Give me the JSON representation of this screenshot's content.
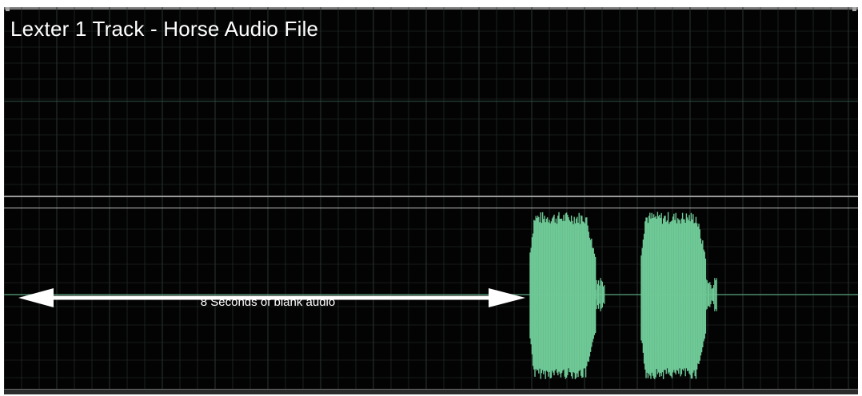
{
  "track_view": {
    "title": "Lexter 1 Track - Horse Audio File",
    "annotation": {
      "label": "8 Seconds of blank audio",
      "arrow_icon": "double-headed-arrow-icon"
    },
    "colors": {
      "background": "#030303",
      "grid": "#2a342f",
      "waveform": "#6ec996",
      "center_line": "#4d8a6a",
      "separator": "#9a9a9a",
      "arrow": "#ffffff"
    }
  }
}
